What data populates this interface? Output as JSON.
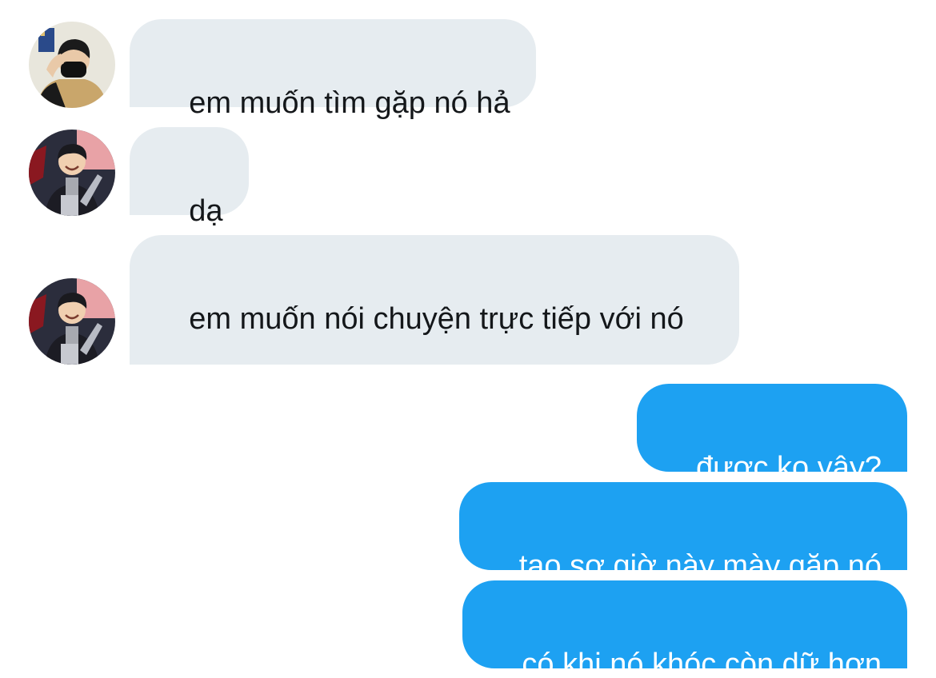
{
  "messages": [
    {
      "direction": "in",
      "avatar": "avatar-masked-person",
      "text": "em muốn tìm gặp nó hả"
    },
    {
      "direction": "in",
      "avatar": "avatar-smiling-person",
      "text": "dạ"
    },
    {
      "direction": "in",
      "avatar": "avatar-smiling-person",
      "text": "em muốn nói chuyện trực tiếp với nó"
    },
    {
      "direction": "out",
      "text": "được ko vậy?"
    },
    {
      "direction": "out",
      "text": "tao sợ giờ này mày gặp nó"
    },
    {
      "direction": "out",
      "text": "có khi nó khóc còn dữ hơn"
    }
  ],
  "colors": {
    "incoming_bubble": "#e6ecf0",
    "incoming_text": "#14171a",
    "outgoing_bubble": "#1da1f2",
    "outgoing_text": "#ffffff"
  }
}
